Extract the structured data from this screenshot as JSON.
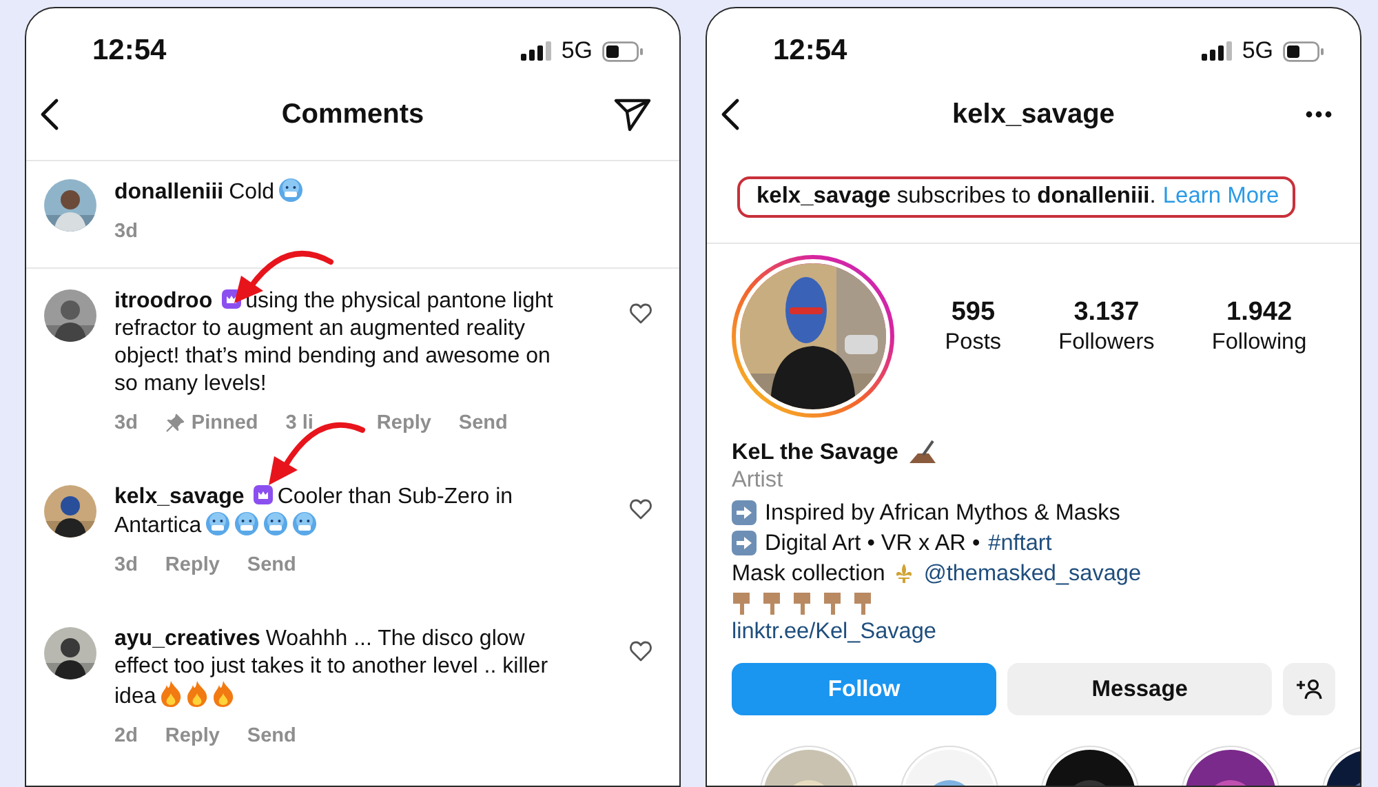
{
  "comments_screen": {
    "status_bar": {
      "time": "12:54",
      "network": "5G"
    },
    "header": {
      "title": "Comments"
    },
    "comments": [
      {
        "kind": "caption",
        "username": "donalleniii",
        "text": "Cold",
        "subscriber_badge": false,
        "emojis": [
          {
            "kind": "cold"
          }
        ],
        "meta": [
          {
            "kind": "time",
            "text": "3d"
          }
        ]
      },
      {
        "kind": "comment",
        "username": "itroodroo",
        "text": "using the physical pantone light refractor to augment an augmented reality object! that’s mind bending and awesome on so many levels!",
        "subscriber_badge": true,
        "liked": false,
        "meta": [
          {
            "kind": "time",
            "text": "3d"
          },
          {
            "kind": "pinned",
            "text": "Pinned"
          },
          {
            "kind": "likes",
            "text": "3 li"
          },
          {
            "kind": "action",
            "text": "Reply"
          },
          {
            "kind": "action",
            "text": "Send"
          }
        ]
      },
      {
        "kind": "comment",
        "username": "kelx_savage",
        "text": "Cooler than Sub-Zero in Antartica",
        "subscriber_badge": true,
        "emojis": [
          {
            "kind": "cold"
          },
          {
            "kind": "cold"
          },
          {
            "kind": "cold"
          },
          {
            "kind": "cold"
          }
        ],
        "liked": false,
        "meta": [
          {
            "kind": "time",
            "text": "3d"
          },
          {
            "kind": "action",
            "text": "Reply"
          },
          {
            "kind": "action",
            "text": "Send"
          }
        ]
      },
      {
        "kind": "comment",
        "username": "ayu_creatives",
        "text": "Woahhh ... The disco glow effect too just takes it to another level .. killer idea",
        "subscriber_badge": false,
        "emojis": [
          {
            "kind": "fire"
          },
          {
            "kind": "fire"
          },
          {
            "kind": "fire"
          }
        ],
        "liked": false,
        "meta": [
          {
            "kind": "time",
            "text": "2d"
          },
          {
            "kind": "action",
            "text": "Reply"
          },
          {
            "kind": "action",
            "text": "Send"
          }
        ]
      }
    ]
  },
  "profile_screen": {
    "status_bar": {
      "time": "12:54",
      "network": "5G"
    },
    "header": {
      "title": "kelx_savage"
    },
    "subscription_notice": {
      "text": "**kelx_savage** subscribes to **donalleniii**.",
      "link": "Learn More"
    },
    "stats": [
      {
        "value": "595",
        "label": "Posts"
      },
      {
        "value": "3.137",
        "label": "Followers"
      },
      {
        "value": "1.942",
        "label": "Following"
      }
    ],
    "name": "KeL the Savage",
    "category": "Artist",
    "bio": [
      {
        "kind": "arrow",
        "text": "Inspired by African Mythos & Masks"
      },
      {
        "kind": "arrow",
        "text": "Digital Art • VR x AR •",
        "link": "#nftart"
      },
      {
        "kind": "mask",
        "text": "Mask collection",
        "link": "@themasked_savage"
      },
      {
        "kind": "hands",
        "icons": [
          {
            "kind": "hand"
          },
          {
            "kind": "hand"
          },
          {
            "kind": "hand"
          },
          {
            "kind": "hand"
          },
          {
            "kind": "hand"
          }
        ]
      }
    ],
    "website": "linktr.ee/Kel_Savage",
    "buttons": [
      {
        "kind": "primary",
        "label": "Follow"
      },
      {
        "kind": "secondary",
        "label": "Message"
      }
    ]
  }
}
